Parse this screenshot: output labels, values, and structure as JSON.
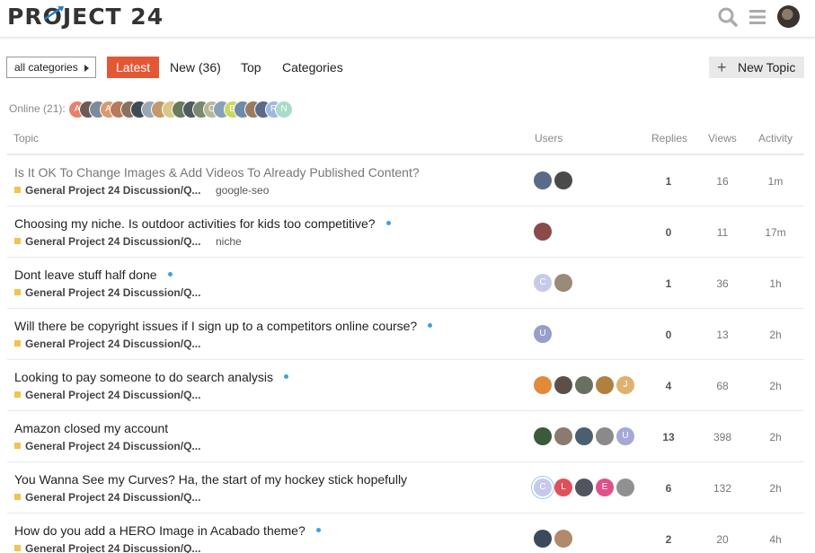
{
  "header": {
    "logo_text": "PROJECT 24",
    "icons": [
      "search-icon",
      "hamburger-menu-icon",
      "user-avatar"
    ]
  },
  "nav": {
    "category_select": "all categories",
    "tabs": [
      "Latest",
      "New (36)",
      "Top",
      "Categories"
    ],
    "active_tab": "Latest",
    "new_topic": "New Topic",
    "accent": "#e45735"
  },
  "online": {
    "label": "Online (21):",
    "avatars": [
      {
        "letter": "A",
        "color": "#e8806a"
      },
      {
        "letter": "",
        "color": "#6b5a55"
      },
      {
        "letter": "",
        "color": "#7c8a9a"
      },
      {
        "letter": "A",
        "color": "#d99a6c"
      },
      {
        "letter": "",
        "color": "#b87a5a"
      },
      {
        "letter": "",
        "color": "#8a7060"
      },
      {
        "letter": "",
        "color": "#3f4a55"
      },
      {
        "letter": "",
        "color": "#9aa7b5"
      },
      {
        "letter": "",
        "color": "#c49a6c"
      },
      {
        "letter": "",
        "color": "#d8c98a"
      },
      {
        "letter": "",
        "color": "#6a7a5a"
      },
      {
        "letter": "",
        "color": "#505a60"
      },
      {
        "letter": "",
        "color": "#7a8a70"
      },
      {
        "letter": "C",
        "color": "#b7b79a"
      },
      {
        "letter": "",
        "color": "#8aa0b8"
      },
      {
        "letter": "B",
        "color": "#c9d860"
      },
      {
        "letter": "",
        "color": "#6e8aa8"
      },
      {
        "letter": "",
        "color": "#9a7a60"
      },
      {
        "letter": "",
        "color": "#5a6a88"
      },
      {
        "letter": "R",
        "color": "#a0b8e0"
      },
      {
        "letter": "N",
        "color": "#a8dcc8"
      }
    ]
  },
  "table": {
    "headers": {
      "topic": "Topic",
      "users": "Users",
      "replies": "Replies",
      "views": "Views",
      "activity": "Activity"
    },
    "rows": [
      {
        "title": "Is It OK To Change Images & Add Videos To Already Published Content?",
        "visited": true,
        "unread": false,
        "category": "General Project 24 Discussion/Q...",
        "tag": "google-seo",
        "users": [
          {
            "l": "",
            "c": "#5a6a88"
          },
          {
            "l": "",
            "c": "#4a4a4a"
          }
        ],
        "replies": "1",
        "views": "16",
        "activity": "1m"
      },
      {
        "title": "Choosing my niche. Is outdoor activities for kids too competitive?",
        "visited": false,
        "unread": true,
        "category": "General Project 24 Discussion/Q...",
        "tag": "niche",
        "users": [
          {
            "l": "",
            "c": "#8a4a4a"
          }
        ],
        "replies": "0",
        "views": "11",
        "activity": "17m"
      },
      {
        "title": "Dont leave stuff half done",
        "visited": false,
        "unread": true,
        "category": "General Project 24 Discussion/Q...",
        "tag": "",
        "users": [
          {
            "l": "C",
            "c": "#c7c9ec"
          },
          {
            "l": "",
            "c": "#9a8a7a"
          }
        ],
        "replies": "1",
        "views": "36",
        "activity": "1h"
      },
      {
        "title": "Will there be copyright issues if I sign up to a competitors online course?",
        "visited": false,
        "unread": true,
        "category": "General Project 24 Discussion/Q...",
        "tag": "",
        "users": [
          {
            "l": "U",
            "c": "#9a9ccc"
          }
        ],
        "replies": "0",
        "views": "13",
        "activity": "2h"
      },
      {
        "title": "Looking to pay someone to do search analysis",
        "visited": false,
        "unread": true,
        "category": "General Project 24 Discussion/Q...",
        "tag": "",
        "users": [
          {
            "l": "",
            "c": "#e08a3a"
          },
          {
            "l": "",
            "c": "#5a5048"
          },
          {
            "l": "",
            "c": "#6a7060"
          },
          {
            "l": "",
            "c": "#b08040"
          },
          {
            "l": "J",
            "c": "#e0b070"
          }
        ],
        "replies": "4",
        "views": "68",
        "activity": "2h"
      },
      {
        "title": "Amazon closed my account",
        "visited": false,
        "unread": false,
        "category": "General Project 24 Discussion/Q...",
        "tag": "",
        "users": [
          {
            "l": "",
            "c": "#3a5a3a"
          },
          {
            "l": "",
            "c": "#8a7a70"
          },
          {
            "l": "",
            "c": "#4a6070"
          },
          {
            "l": "",
            "c": "#8a8a8a"
          },
          {
            "l": "U",
            "c": "#a6a8d8"
          }
        ],
        "replies": "13",
        "views": "398",
        "activity": "2h"
      },
      {
        "title": "You Wanna See my Curves? Ha, the start of my hockey stick hopefully",
        "visited": false,
        "unread": false,
        "category": "General Project 24 Discussion/Q...",
        "tag": "",
        "users": [
          {
            "l": "C",
            "c": "#c7c9ec"
          },
          {
            "l": "L",
            "c": "#e0505a"
          },
          {
            "l": "",
            "c": "#505560"
          },
          {
            "l": "E",
            "c": "#e0508a"
          },
          {
            "l": "",
            "c": "#909090"
          }
        ],
        "replies": "6",
        "views": "132",
        "activity": "2h"
      },
      {
        "title": "How do you add a HERO Image in Acabado theme?",
        "visited": false,
        "unread": true,
        "category": "General Project 24 Discussion/Q...",
        "tag": "",
        "users": [
          {
            "l": "",
            "c": "#3a4a5a"
          },
          {
            "l": "",
            "c": "#b08a6a"
          }
        ],
        "replies": "2",
        "views": "20",
        "activity": "4h"
      }
    ]
  }
}
